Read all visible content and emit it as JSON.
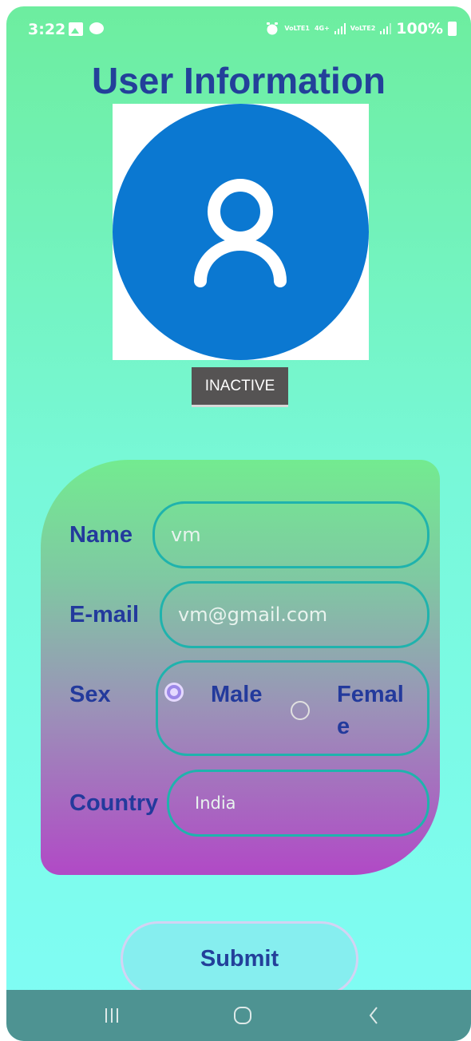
{
  "status_bar": {
    "time": "3:22",
    "volte1": "VoLTE1",
    "fourg": "4G+",
    "volte2": "VoLTE2",
    "battery": "100%"
  },
  "page": {
    "title": "User Information"
  },
  "profile": {
    "status_button": "INACTIVE"
  },
  "form": {
    "name_label": "Name",
    "name_value": "vm",
    "email_label": "E-mail",
    "email_value": "vm@gmail.com",
    "sex_label": "Sex",
    "sex_options": [
      {
        "label": "Male",
        "selected": true
      },
      {
        "label": "Femal e",
        "selected": false
      }
    ],
    "country_label": "Country",
    "country_value": "India"
  },
  "actions": {
    "submit_label": "Submit"
  },
  "colors": {
    "title": "#23409a",
    "avatar": "#0b78d1",
    "field_border": "#1fb3ad",
    "nav_bar": "#4e9392"
  }
}
